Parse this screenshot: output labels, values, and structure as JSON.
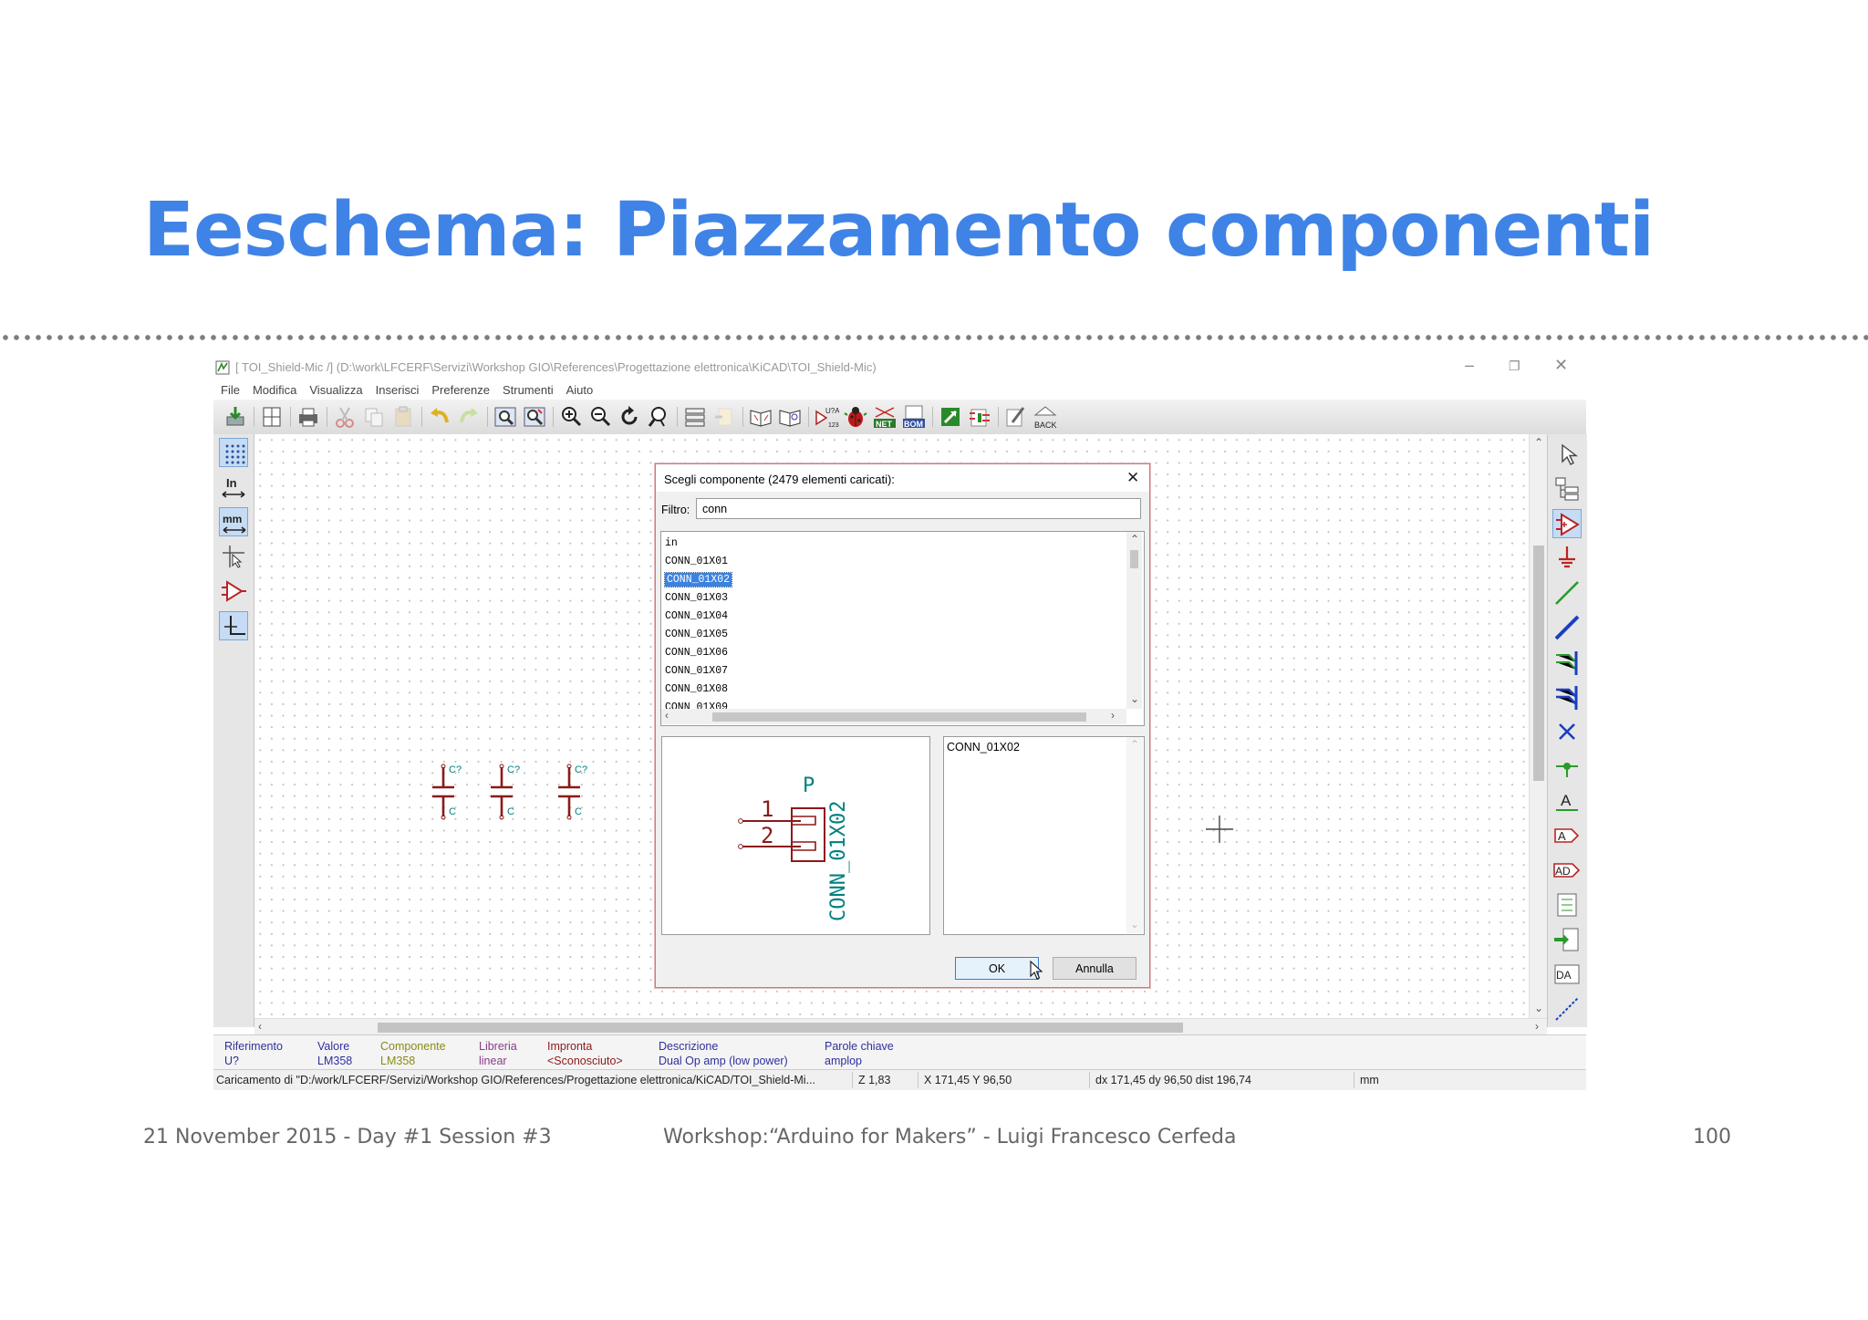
{
  "slide": {
    "title": "Eeschema: Piazzamento componenti",
    "footer_left": "21 November 2015 - Day #1 Session #3",
    "footer_center": "Workshop:“Arduino for Makers” - Luigi Francesco Cerfeda",
    "footer_page": "100"
  },
  "window": {
    "title": "[ TOI_Shield-Mic /] (D:\\work\\LFCERF\\Servizi\\Workshop GIO\\References\\Progettazione elettronica\\KiCAD\\TOI_Shield-Mic)",
    "minimize": "–",
    "restore": "❐",
    "close": "✕"
  },
  "menu": [
    "File",
    "Modifica",
    "Visualizza",
    "Inserisci",
    "Preferenze",
    "Strumenti",
    "Aiuto"
  ],
  "toolbar": {
    "annotate_label": "U?A",
    "annotate_sub": "123",
    "net_label": "NET",
    "bom_label": "BOM",
    "back_label": "BACK"
  },
  "left_toolbar": {
    "units_in": "In",
    "units_mm": "mm"
  },
  "right_toolbar": {
    "text_label": "A",
    "global_label": "A",
    "hier_label": "AD",
    "import_label": "DA"
  },
  "canvas_caps": [
    {
      "ref": "C?",
      "value": "C"
    },
    {
      "ref": "C?",
      "value": "C"
    },
    {
      "ref": "C?",
      "value": "C"
    }
  ],
  "dialog": {
    "title": "Scegli componente (2479 elementi caricati):",
    "close": "✕",
    "filter_label": "Filtro:",
    "filter_value": "conn",
    "list_items": [
      "in",
      "CONN_01X01",
      "CONN_01X02",
      "CONN_01X03",
      "CONN_01X04",
      "CONN_01X05",
      "CONN_01X06",
      "CONN_01X07",
      "CONN_01X08",
      "CONN_01X09"
    ],
    "selected_item": "CONN_01X02",
    "preview": {
      "ref": "P",
      "value": "CONN_01X02",
      "pin1": "1",
      "pin2": "2"
    },
    "description": "CONN_01X02",
    "ok": "OK",
    "cancel": "Annulla"
  },
  "infobar": [
    {
      "label": "Riferimento",
      "value": "U?",
      "color": "#2f2f9e"
    },
    {
      "label": "Valore",
      "value": "LM358",
      "color": "#2f2f9e"
    },
    {
      "label": "Componente",
      "value": "LM358",
      "color": "#8a8a1a"
    },
    {
      "label": "Libreria",
      "value": "linear",
      "color": "#8a3a8a"
    },
    {
      "label": "Impronta",
      "value": "<Sconosciuto>",
      "color": "#8a1a1a"
    },
    {
      "label": "Descrizione",
      "value": "Dual Op amp (low power)",
      "color": "#2f2f9e"
    },
    {
      "label": "Parole chiave",
      "value": "amplop",
      "color": "#2f2f9e"
    }
  ],
  "status": {
    "message": "Caricamento di \"D:/work/LFCERF/Servizi/Workshop GIO/References/Progettazione elettronica/KiCAD/TOI_Shield-Mi...",
    "zoom": "Z 1,83",
    "coords": "X 171,45  Y 96,50",
    "delta": "dx 171,45  dy 96,50  dist 196,74",
    "units": "mm"
  },
  "colors": {
    "title_blue": "#3f83e6",
    "schematic_red": "#8b1a1a",
    "schematic_teal": "#008080",
    "selection_blue": "#3b83e0"
  }
}
